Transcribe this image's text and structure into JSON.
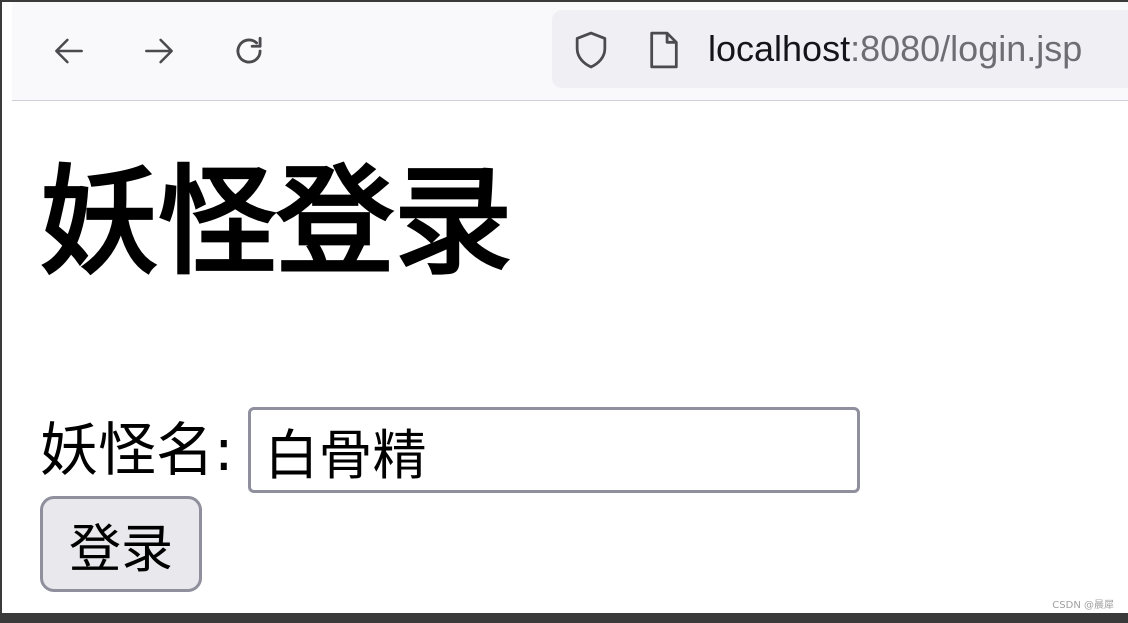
{
  "browser": {
    "nav": {
      "back_icon": "arrow-left-icon",
      "forward_icon": "arrow-right-icon",
      "reload_icon": "reload-icon"
    },
    "address": {
      "host": "localhost",
      "rest": ":8080/login.jsp",
      "security_icon": "shield-icon",
      "page_icon": "page-icon"
    }
  },
  "page": {
    "heading": "妖怪登录",
    "form": {
      "name_label": "妖怪名:",
      "name_value": "白骨精",
      "submit_label": "登录"
    }
  },
  "watermark": "CSDN @晨犀",
  "colors": {
    "toolbar_bg": "#f9f9fb",
    "urlbar_bg": "#f0f0f4",
    "button_bg": "#e9e9ed",
    "border": "#8f8f9d"
  }
}
